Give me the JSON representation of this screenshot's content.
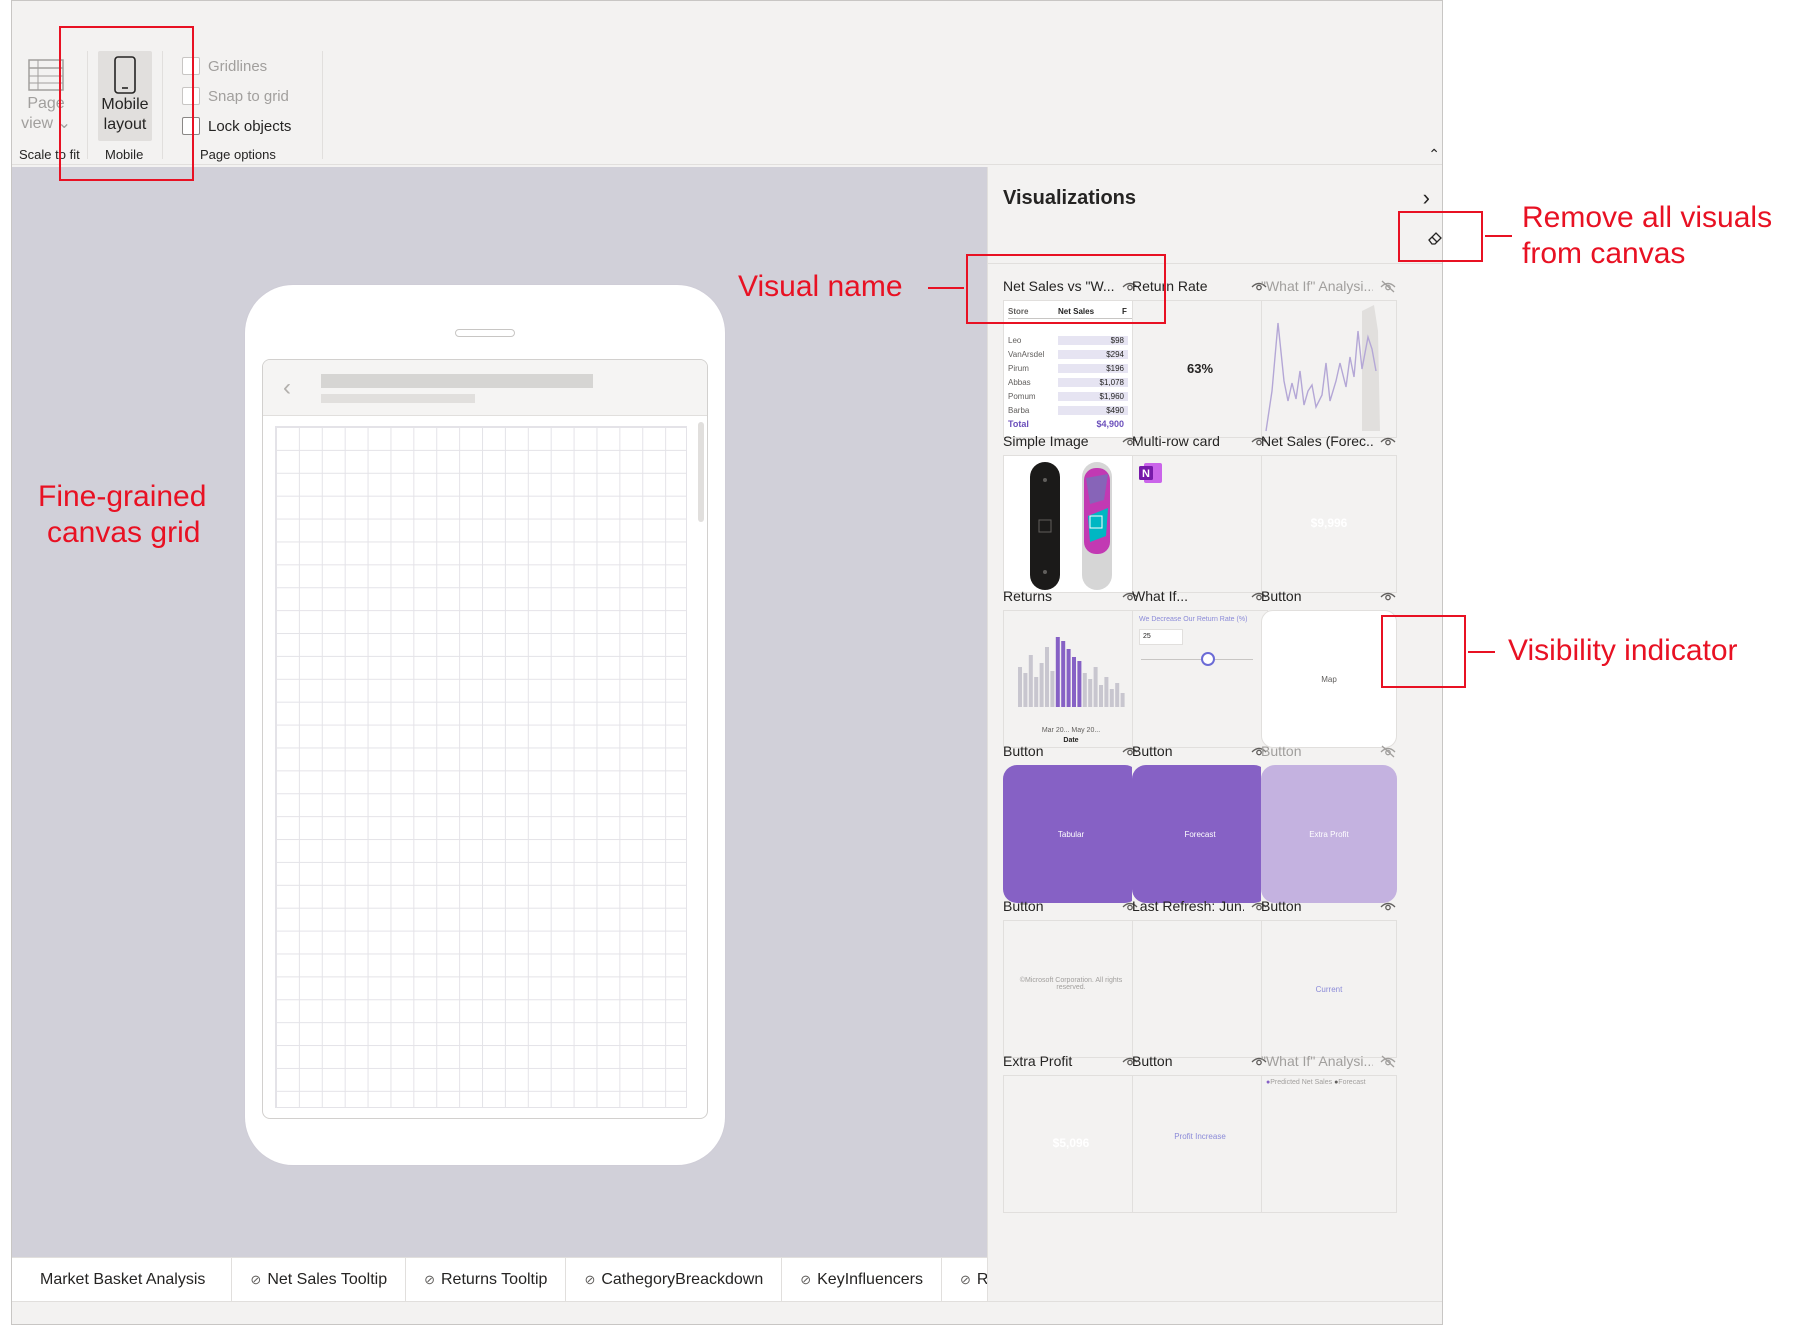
{
  "ribbon": {
    "page_view": {
      "line1": "Page",
      "line2": "view"
    },
    "mobile_layout": {
      "line1": "Mobile",
      "line2": "layout"
    },
    "group_scale": "Scale to fit",
    "group_mobile": "Mobile",
    "group_page_options": "Page options",
    "gridlines": "Gridlines",
    "snap_to_grid": "Snap to grid",
    "lock_objects": "Lock objects"
  },
  "pane": {
    "title": "Visualizations",
    "cells": [
      {
        "title": "Net Sales vs \"W...",
        "visible": true
      },
      {
        "title": "Return Rate",
        "visible": true,
        "value": "63%"
      },
      {
        "title": "\"What If\" Analysi...",
        "visible": false
      },
      {
        "title": "Simple Image",
        "visible": true
      },
      {
        "title": "Multi-row card",
        "visible": true
      },
      {
        "title": "Net Sales (Forec...",
        "visible": true,
        "value": "$9,996"
      },
      {
        "title": "Returns",
        "visible": true,
        "axis_ticks": "Mar 20... May 20...",
        "axis_label": "Date"
      },
      {
        "title": "What If...",
        "visible": true,
        "slider_label": "We Decrease Our Return Rate (%)",
        "slider_value": "25"
      },
      {
        "title": "Button",
        "visible": true,
        "text": "Map"
      },
      {
        "title": "Button",
        "visible": true,
        "text": "Tabular"
      },
      {
        "title": "Button",
        "visible": true,
        "text": "Forecast"
      },
      {
        "title": "Button",
        "visible": false,
        "text": "Extra Profit"
      },
      {
        "title": "Button",
        "visible": true,
        "text": "©Microsoft Corporation. All rights reserved."
      },
      {
        "title": "Last Refresh: Jun...",
        "visible": true
      },
      {
        "title": "Button",
        "visible": true,
        "text": "Current"
      },
      {
        "title": "Extra Profit",
        "visible": true,
        "value": "$5,096"
      },
      {
        "title": "Button",
        "visible": true,
        "text": "Profit Increase"
      },
      {
        "title": "\"What If\" Analysi...",
        "visible": false,
        "legend1": "Predicted Net Sales",
        "legend2": "Forecast"
      }
    ],
    "table": {
      "headers": [
        "Store",
        "Net Sales",
        "F"
      ],
      "rows": [
        {
          "store": "Leo",
          "net_sales": "$98"
        },
        {
          "store": "VanArsdel",
          "net_sales": "$294"
        },
        {
          "store": "Pirum",
          "net_sales": "$196"
        },
        {
          "store": "Abbas",
          "net_sales": "$1,078"
        },
        {
          "store": "Pomum",
          "net_sales": "$1,960"
        },
        {
          "store": "Barba",
          "net_sales": "$490"
        }
      ],
      "total_label": "Total",
      "total_value": "$4,900"
    }
  },
  "tabs": [
    {
      "label": "Market Basket Analysis",
      "hidden": false
    },
    {
      "label": "Net Sales Tooltip",
      "hidden": true
    },
    {
      "label": "Returns Tooltip",
      "hidden": true
    },
    {
      "label": "CathegoryBreackdown",
      "hidden": true
    },
    {
      "label": "KeyInfluencers",
      "hidden": true
    },
    {
      "label": "RetK",
      "hidden": true
    }
  ],
  "annotations": {
    "visual_name": "Visual name",
    "remove_all_line1": "Remove all visuals",
    "remove_all_line2": "from canvas",
    "visibility": "Visibility indicator",
    "grid_line1": "Fine-grained",
    "grid_line2": "canvas grid"
  },
  "colors": {
    "accent_purple": "#8661c5",
    "accent_purple_light": "#c4b2e0",
    "annotation_red": "#e81123",
    "canvas_bg": "#d1d0d9"
  }
}
